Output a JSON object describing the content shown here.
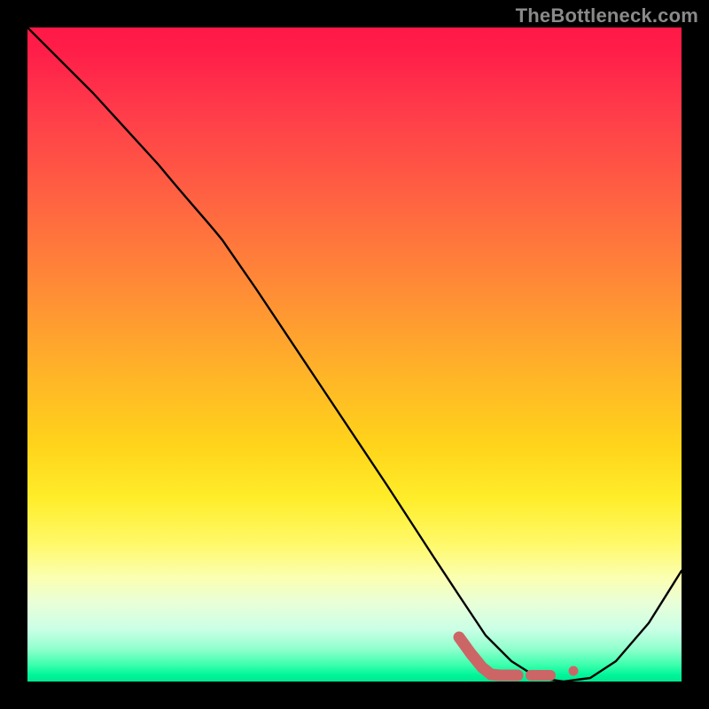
{
  "watermark": "TheBottleneck.com",
  "chart_data": {
    "type": "line",
    "title": "",
    "xlabel": "",
    "ylabel": "",
    "xlim": [
      0,
      1
    ],
    "ylim": [
      0,
      1
    ],
    "grid": false,
    "legend": false,
    "series": [
      {
        "name": "curve",
        "color": "#000000",
        "x": [
          0.0,
          0.1,
          0.2,
          0.27,
          0.35,
          0.45,
          0.55,
          0.62,
          0.66,
          0.7,
          0.74,
          0.78,
          0.82,
          0.86,
          0.9,
          0.95,
          1.0
        ],
        "y": [
          1.0,
          0.9,
          0.79,
          0.71,
          0.6,
          0.45,
          0.3,
          0.19,
          0.13,
          0.07,
          0.03,
          0.005,
          0.0,
          0.005,
          0.03,
          0.09,
          0.17
        ]
      },
      {
        "name": "highlight-l",
        "color": "#cc6666",
        "style": "thick",
        "x": [
          0.66,
          0.695,
          0.72,
          0.75
        ],
        "y": [
          0.07,
          0.02,
          0.01,
          0.01
        ]
      },
      {
        "name": "highlight-dot-a",
        "color": "#cc6666",
        "style": "dot",
        "x": [
          0.78
        ],
        "y": [
          0.01
        ]
      },
      {
        "name": "highlight-dot-b",
        "color": "#cc6666",
        "style": "dot-small",
        "x": [
          0.835
        ],
        "y": [
          0.018
        ]
      }
    ],
    "gradient_stops": [
      {
        "pos": 0.0,
        "color": "#ff1846"
      },
      {
        "pos": 0.5,
        "color": "#ffb428"
      },
      {
        "pos": 0.8,
        "color": "#fff96a"
      },
      {
        "pos": 0.97,
        "color": "#3affac"
      },
      {
        "pos": 1.0,
        "color": "#00e890"
      }
    ]
  }
}
